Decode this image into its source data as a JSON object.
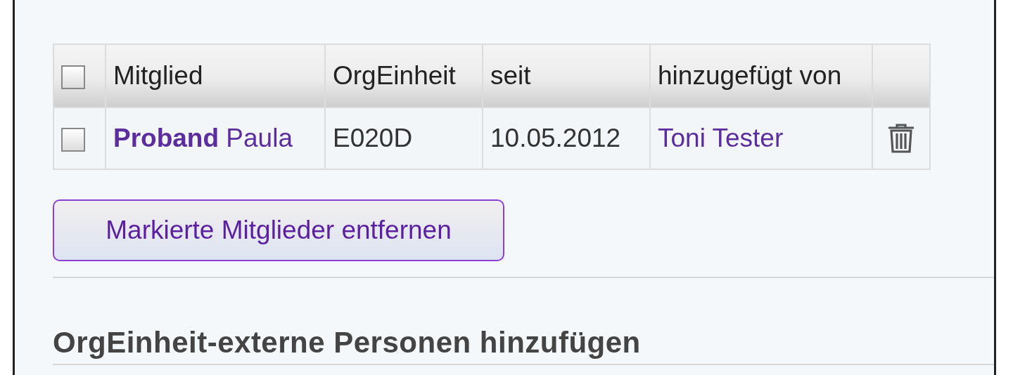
{
  "table": {
    "select_all": {
      "checked": false
    },
    "columns": [
      "Mitglied",
      "OrgEinheit",
      "seit",
      "hinzugefügt von"
    ],
    "rows": [
      {
        "checked": false,
        "member": "**Proband** Paula",
        "org_unit": "E020D",
        "since": "10.05.2012",
        "added_by": "Toni Tester"
      }
    ]
  },
  "remove_button": "Markierte Mitglieder entfernen",
  "section_heading": "OrgEinheit-externe Personen hinzufügen"
}
